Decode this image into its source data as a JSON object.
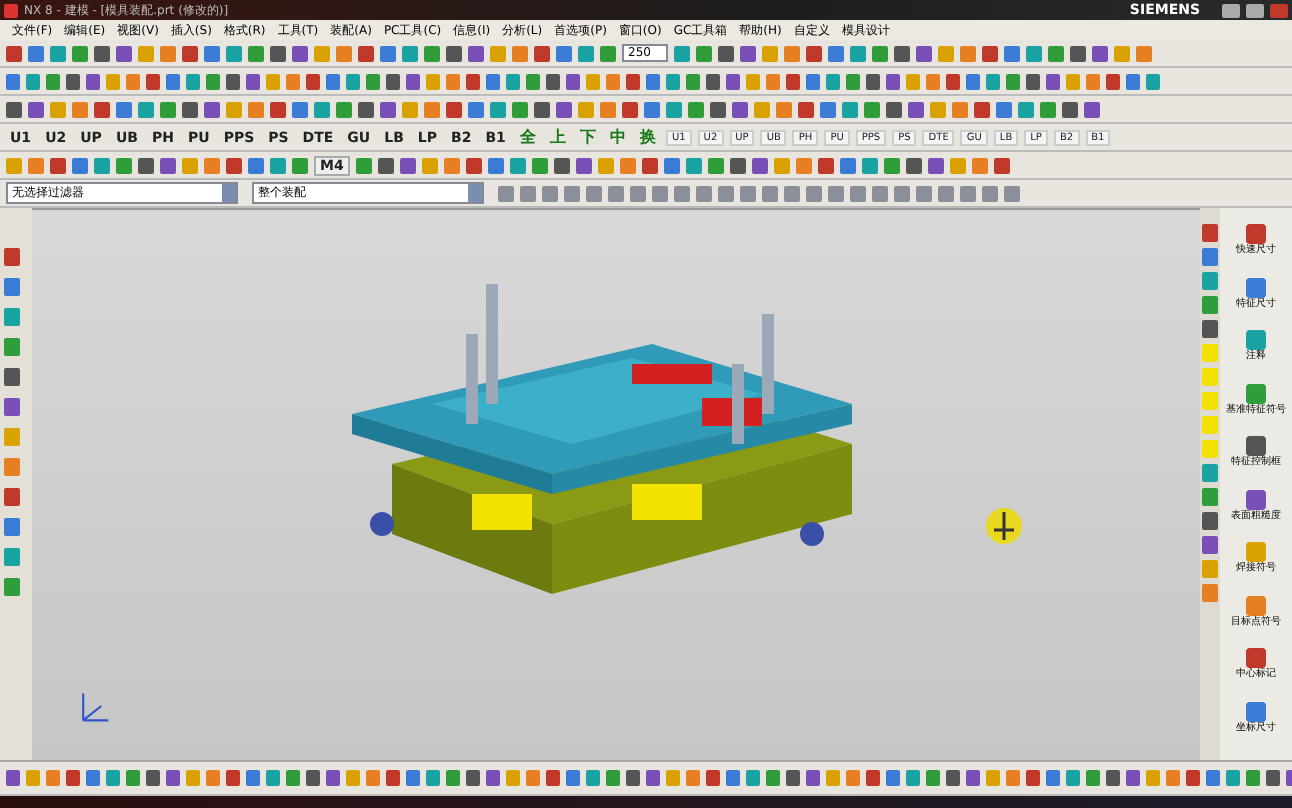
{
  "window": {
    "title": "NX 8 - 建模 - [模具装配.prt (修改的)]",
    "brand": "SIEMENS"
  },
  "menu": [
    "文件(F)",
    "编辑(E)",
    "视图(V)",
    "插入(S)",
    "格式(R)",
    "工具(T)",
    "装配(A)",
    "PC工具(C)",
    "信息(I)",
    "分析(L)",
    "首选项(P)",
    "窗口(O)",
    "GC工具箱",
    "帮助(H)",
    "自定义",
    "模具设计"
  ],
  "zoom_field": {
    "value": "250"
  },
  "mold_buttons": [
    "U1",
    "U2",
    "UP",
    "UB",
    "PH",
    "PU",
    "PPS",
    "PS",
    "DTE",
    "GU",
    "LB",
    "LP",
    "B2",
    "B1"
  ],
  "plate_buttons": [
    "全",
    "上",
    "下",
    "中",
    "换"
  ],
  "sub_buttons": [
    "U1",
    "U2",
    "UP",
    "UB",
    "PH",
    "PU",
    "PPS",
    "PS",
    "DTE",
    "GU",
    "LB",
    "LP",
    "B2",
    "B1"
  ],
  "special_button": "M4",
  "filters": [
    {
      "value": "无选择过滤器"
    },
    {
      "value": "整个装配"
    }
  ],
  "resource_bar": [
    "快速尺寸",
    "特征尺寸",
    "注释",
    "基准特征符号",
    "特征控制框",
    "表面粗糙度",
    "焊接符号",
    "目标点符号",
    "中心标记",
    "坐标尺寸"
  ]
}
